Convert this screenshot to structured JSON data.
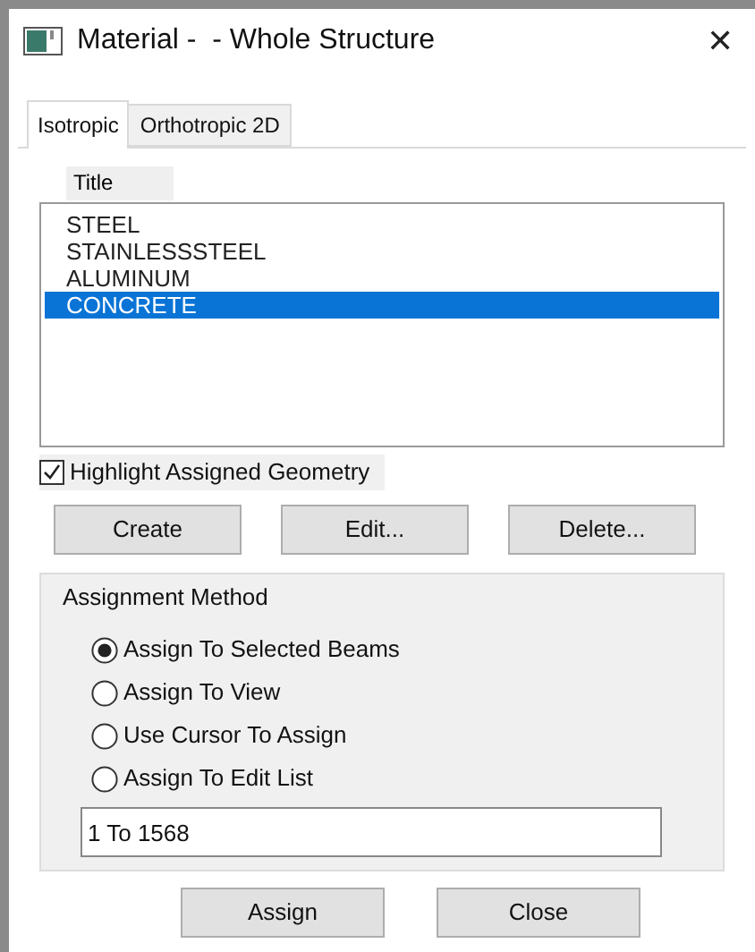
{
  "window": {
    "title": "Material -  - Whole Structure",
    "close": "✕"
  },
  "tabs": [
    {
      "label": "Isotropic",
      "selected": true
    },
    {
      "label": "Orthotropic 2D",
      "selected": false
    }
  ],
  "list": {
    "header": "Title",
    "items": [
      {
        "label": "STEEL",
        "selected": false
      },
      {
        "label": "STAINLESSSTEEL",
        "selected": false
      },
      {
        "label": "ALUMINUM",
        "selected": false
      },
      {
        "label": "CONCRETE",
        "selected": true
      }
    ]
  },
  "highlight": {
    "label": "Highlight Assigned Geometry",
    "checked": true
  },
  "buttons": [
    "Create",
    "Edit...",
    "Delete..."
  ],
  "assignment": {
    "title": "Assignment Method",
    "options": [
      {
        "label": "Assign To Selected Beams",
        "selected": true
      },
      {
        "label": "Assign To View",
        "selected": false
      },
      {
        "label": "Use Cursor To Assign",
        "selected": false
      },
      {
        "label": "Assign To Edit List",
        "selected": false
      }
    ],
    "value": "1 To 1568"
  },
  "footer_buttons": [
    "Assign",
    "Close"
  ]
}
